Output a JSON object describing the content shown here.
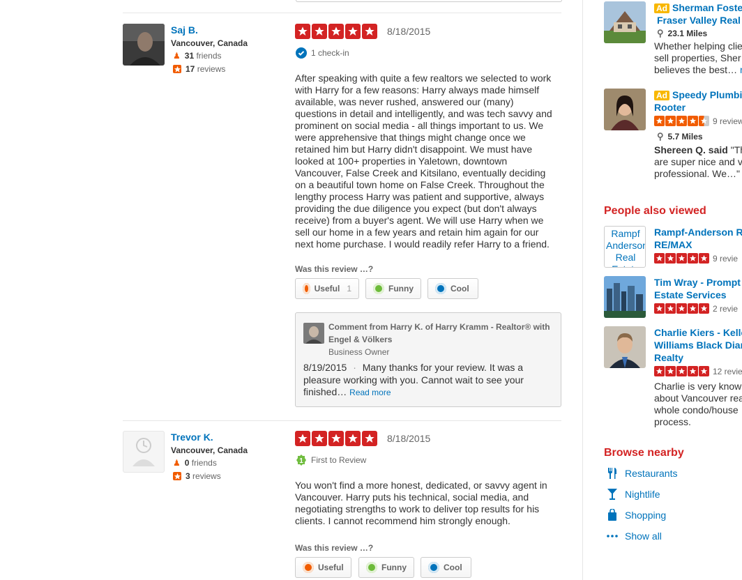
{
  "reviews": [
    {
      "user": {
        "name": "Saj B.",
        "location": "Vancouver, Canada",
        "friends": "31",
        "friends_label": "friends",
        "reviews": "17",
        "reviews_label": "reviews"
      },
      "rating": 5,
      "date": "8/18/2015",
      "badge": "1 check-in",
      "text": "After speaking with quite a few realtors we selected to work with Harry for a few reasons: Harry always made himself available, was never rushed, answered our (many) questions in detail and intelligently, and was tech savvy and prominent on social media - all things important to us. We were apprehensive that things might change once we retained him but Harry didn't disappoint. We must have looked at 100+ properties in Yaletown, downtown Vancouver, False Creek and Kitsilano, eventually deciding on a beautiful town home on False Creek. Throughout the lengthy process Harry was patient and supportive, always providing the due diligence you expect (but don't always receive) from a buyer's agent. We will use Harry when we sell our home in a few years and retain him again for our next home purchase. I would readily refer Harry to a friend.",
      "was_label": "Was this review …?",
      "useful": "Useful",
      "useful_count": "1",
      "funny": "Funny",
      "cool": "Cool",
      "comment": {
        "title": "Comment from Harry K. of Harry Kramm - Realtor® with Engel & Völkers",
        "role": "Business Owner",
        "date": "8/19/2015",
        "sep": "·",
        "text": "Many thanks for your review. It was a pleasure working with you. Cannot wait to see your finished…",
        "read_more": "Read more"
      }
    },
    {
      "user": {
        "name": "Trevor K.",
        "location": "Vancouver, Canada",
        "friends": "0",
        "friends_label": "friends",
        "reviews": "3",
        "reviews_label": "reviews"
      },
      "rating": 5,
      "date": "8/18/2015",
      "badge": "First to Review",
      "text": "You won't find a more honest, dedicated, or savvy agent in Vancouver. Harry puts his technical, social media, and negotiating strengths to work to deliver top results for his clients. I cannot recommend him strongly enough.",
      "was_label": "Was this review …?",
      "useful": "Useful",
      "funny": "Funny",
      "cool": "Cool"
    }
  ],
  "sidebar": {
    "ads": [
      {
        "ad": "Ad",
        "title1": "Sherman Foste",
        "title2": "Fraser Valley Real",
        "miles": "23.1 Miles",
        "text": [
          "Whether helping clie",
          "sell properties, Sher",
          "believes the best…"
        ]
      },
      {
        "ad": "Ad",
        "title1": "Speedy Plumbi",
        "title2": "Rooter",
        "rating": 4.5,
        "count": "9 review",
        "miles": "5.7 Miles",
        "quote_author": "Shereen Q. said",
        "quote": "\"Th",
        "text": [
          "are super nice and v",
          "professional. We…\""
        ]
      }
    ],
    "people_also_viewed": {
      "heading": "People also viewed",
      "items": [
        {
          "title1": "Rampf-Anderson R",
          "title2": "RE/MAX",
          "rating": 5,
          "count": "9 revie",
          "img_alt": "Rampf Anderson Real Estate"
        },
        {
          "title1": "Tim Wray - Prompt",
          "title2": "Estate Services",
          "rating": 5,
          "count": "2 revie"
        },
        {
          "title1": "Charlie Kiers - Kelle",
          "title2": "Williams Black Diar",
          "title3": "Realty",
          "rating": 5,
          "count": "12 revie",
          "text": [
            "Charlie is very know",
            "about Vancouver rea",
            "whole condo/house",
            "process."
          ]
        }
      ]
    },
    "browse_nearby": {
      "heading": "Browse nearby",
      "items": [
        {
          "label": "Restaurants",
          "icon": "fork-knife-icon"
        },
        {
          "label": "Nightlife",
          "icon": "cocktail-icon"
        },
        {
          "label": "Shopping",
          "icon": "shopping-bag-icon"
        },
        {
          "label": "Show all",
          "icon": "more-dots-icon"
        }
      ]
    }
  },
  "colors": {
    "accent_red": "#d32323",
    "link_blue": "#0073bb",
    "orange": "#f15c00",
    "ad_yellow": "#f8b700"
  }
}
